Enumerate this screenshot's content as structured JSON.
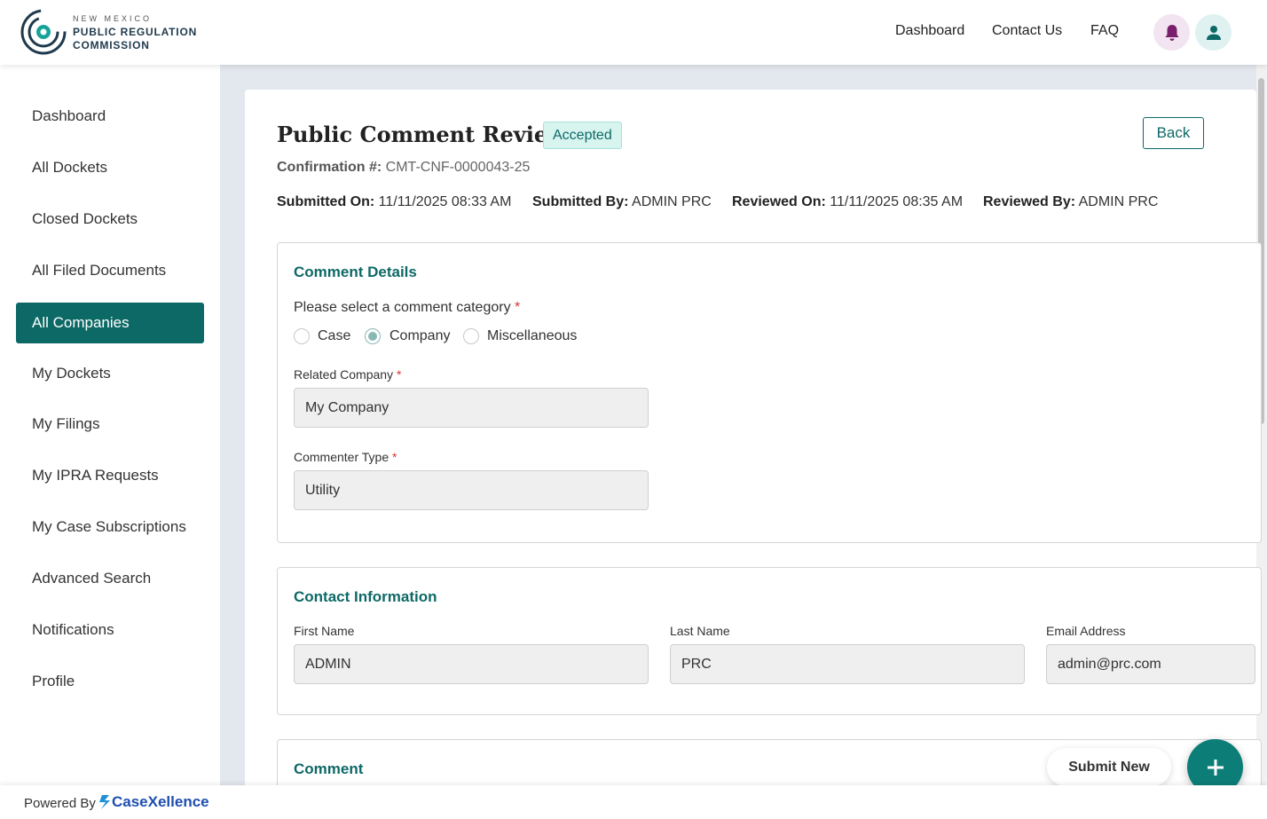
{
  "header": {
    "logo_line1": "NEW MEXICO",
    "logo_line2": "PUBLIC REGULATION",
    "logo_line3": "COMMISSION",
    "nav": [
      "Dashboard",
      "Contact Us",
      "FAQ"
    ],
    "bell_icon": "bell-icon",
    "user_icon": "user-icon"
  },
  "sidebar": {
    "items": [
      {
        "label": "Dashboard"
      },
      {
        "label": "All Dockets"
      },
      {
        "label": "Closed Dockets"
      },
      {
        "label": "All Filed Documents"
      },
      {
        "label": "All Companies"
      },
      {
        "label": "My Dockets"
      },
      {
        "label": "My Filings"
      },
      {
        "label": "My IPRA Requests"
      },
      {
        "label": "My Case Subscriptions"
      },
      {
        "label": "Advanced Search"
      },
      {
        "label": "Notifications"
      },
      {
        "label": "Profile"
      }
    ],
    "active": "All Companies"
  },
  "page": {
    "title": "Public Comment Review",
    "status": "Accepted",
    "back_label": "Back",
    "confirmation_label": "Confirmation #:",
    "confirmation_value": "CMT-CNF-0000043-25",
    "meta": [
      {
        "label": "Submitted On:",
        "value": "11/11/2025 08:33 AM"
      },
      {
        "label": "Submitted By:",
        "value": "ADMIN PRC"
      },
      {
        "label": "Reviewed On:",
        "value": "11/11/2025 08:35 AM"
      },
      {
        "label": "Reviewed By:",
        "value": "ADMIN PRC"
      }
    ]
  },
  "comment_details": {
    "title": "Comment Details",
    "category_question": "Please select a comment category",
    "category_options": [
      "Case",
      "Company",
      "Miscellaneous"
    ],
    "category_selected": "Company",
    "related_company_label": "Related Company",
    "related_company_value": "My Company",
    "commenter_type_label": "Commenter Type",
    "commenter_type_value": "Utility",
    "required_mark": "*"
  },
  "contact": {
    "title": "Contact Information",
    "first_name_label": "First Name",
    "first_name_value": "ADMIN",
    "last_name_label": "Last Name",
    "last_name_value": "PRC",
    "email_label": "Email Address",
    "email_value": "admin@prc.com"
  },
  "comment": {
    "title": "Comment"
  },
  "actions": {
    "submit_new_label": "Submit New"
  },
  "footer": {
    "powered_by": "Powered By",
    "brand": "CaseXellence"
  },
  "colors": {
    "accent": "#0d6966",
    "badge_bg": "#d7f4ef",
    "required": "#d93636",
    "bell": "#7a1f6b",
    "brand": "#1f4fb0"
  }
}
